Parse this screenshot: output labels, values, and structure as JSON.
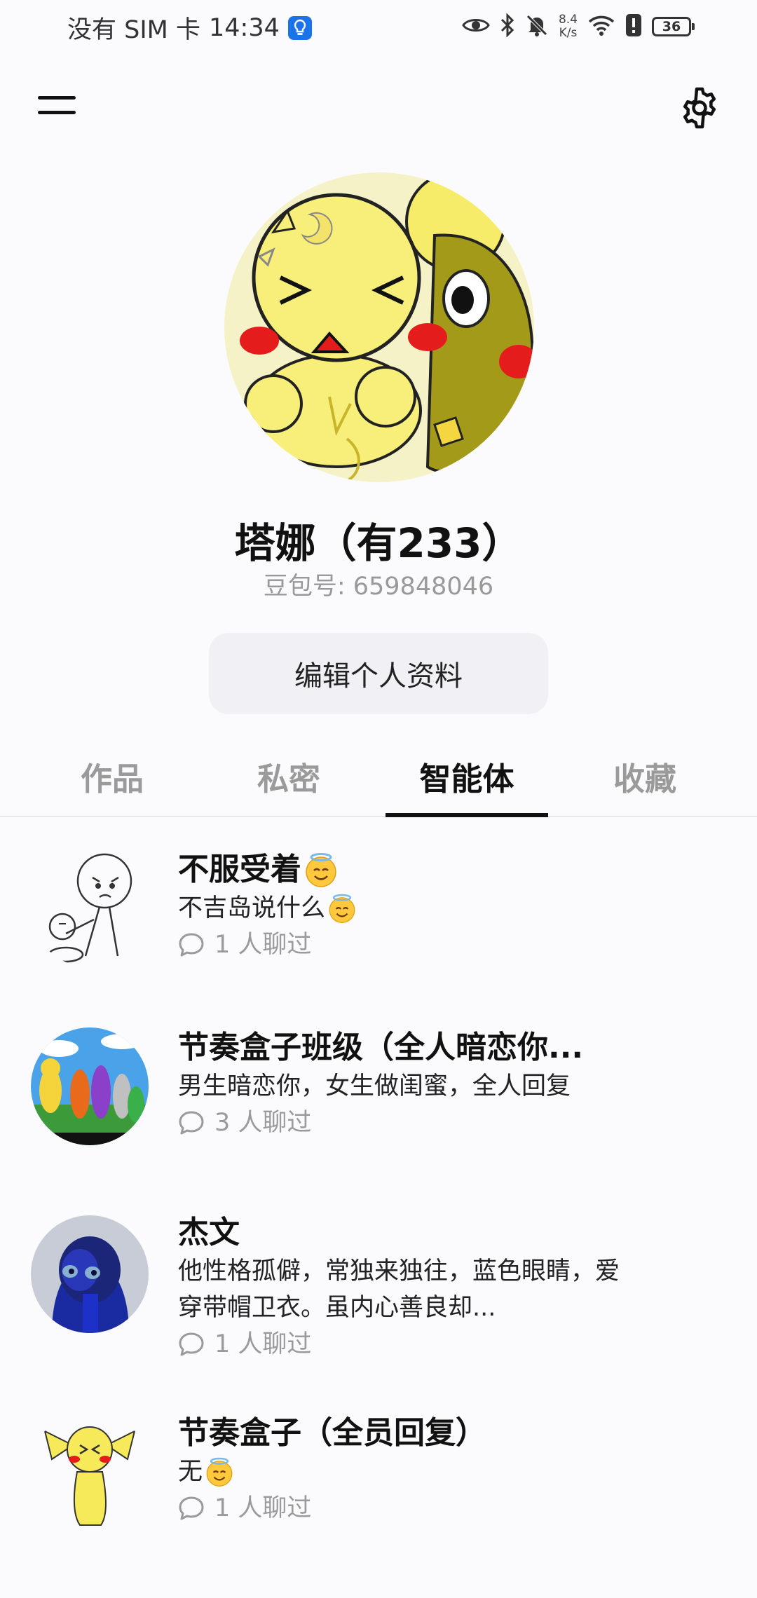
{
  "status_bar": {
    "carrier": "没有 SIM 卡",
    "time": "14:34",
    "network_speed_value": "8.4",
    "network_speed_unit": "K/s",
    "battery": "36"
  },
  "icons": {
    "menu": "menu-icon",
    "settings": "gear-icon",
    "chat": "chat-bubble-icon",
    "emoji": "smiling-face-with-halo-emoji"
  },
  "profile": {
    "name": "塔娜（有233）",
    "doubao_id": "豆包号: 659848046",
    "edit_button": "编辑个人资料"
  },
  "tabs": [
    {
      "label": "作品",
      "active": false
    },
    {
      "label": "私密",
      "active": false
    },
    {
      "label": "智能体",
      "active": true
    },
    {
      "label": "收藏",
      "active": false
    }
  ],
  "agents": [
    {
      "title": "不服受着",
      "description": "不吉岛说什么",
      "chats": "1 人聊过"
    },
    {
      "title": "节奏盒子班级（全人暗恋你...",
      "description": "男生暗恋你，女生做闺蜜，全人回复",
      "chats": "3 人聊过"
    },
    {
      "title": "杰文",
      "description": "他性格孤僻，常独来独往，蓝色眼睛，爱穿带帽卫衣。虽内心善良却...",
      "chats": "1 人聊过"
    },
    {
      "title": "节奏盒子（全员回复）",
      "description": "无",
      "chats": "1 人聊过"
    }
  ],
  "colors": {
    "background": "#fbfbfd",
    "accent": "#111111",
    "muted_text": "#9a9a9a",
    "button_bg": "#f1f0f4"
  }
}
